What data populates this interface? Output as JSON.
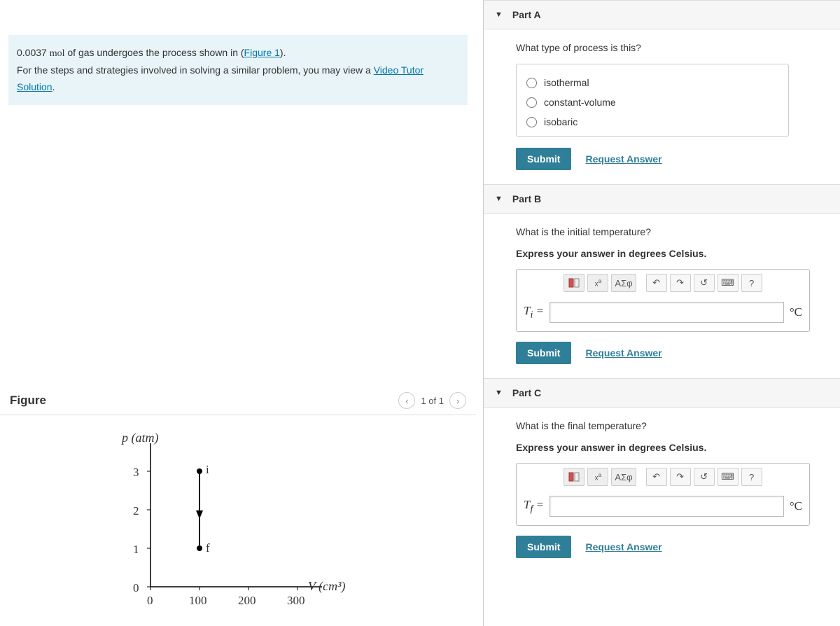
{
  "problem": {
    "line1_a": "0.0037 ",
    "line1_unit": "mol",
    "line1_b": " of gas undergoes the process shown in (",
    "figure_link": "Figure 1",
    "line1_c": ").",
    "line2_a": "For the steps and strategies involved in solving a similar problem, you may view a ",
    "video_link": "Video Tutor Solution",
    "line2_b": "."
  },
  "figure": {
    "title": "Figure",
    "pager_text": "1 of 1",
    "ylabel": "p (atm)",
    "xlabel": "V (cm³)",
    "yticks": [
      "0",
      "1",
      "2",
      "3"
    ],
    "xticks": [
      "0",
      "100",
      "200",
      "300"
    ],
    "points": {
      "i": "i",
      "f": "f"
    }
  },
  "partA": {
    "title": "Part A",
    "question": "What type of process is this?",
    "options": [
      "isothermal",
      "constant-volume",
      "isobaric"
    ],
    "submit": "Submit",
    "request": "Request Answer"
  },
  "partB": {
    "title": "Part B",
    "question": "What is the initial temperature?",
    "instruction": "Express your answer in degrees Celsius.",
    "var_label": "Tᵢ =",
    "unit": "°C",
    "submit": "Submit",
    "request": "Request Answer",
    "toolbar": {
      "greek": "ΑΣφ",
      "help": "?"
    }
  },
  "partC": {
    "title": "Part C",
    "question": "What is the final temperature?",
    "instruction": "Express your answer in degrees Celsius.",
    "var_label": "Tf =",
    "unit": "°C",
    "submit": "Submit",
    "request": "Request Answer",
    "toolbar": {
      "greek": "ΑΣφ",
      "help": "?"
    }
  }
}
